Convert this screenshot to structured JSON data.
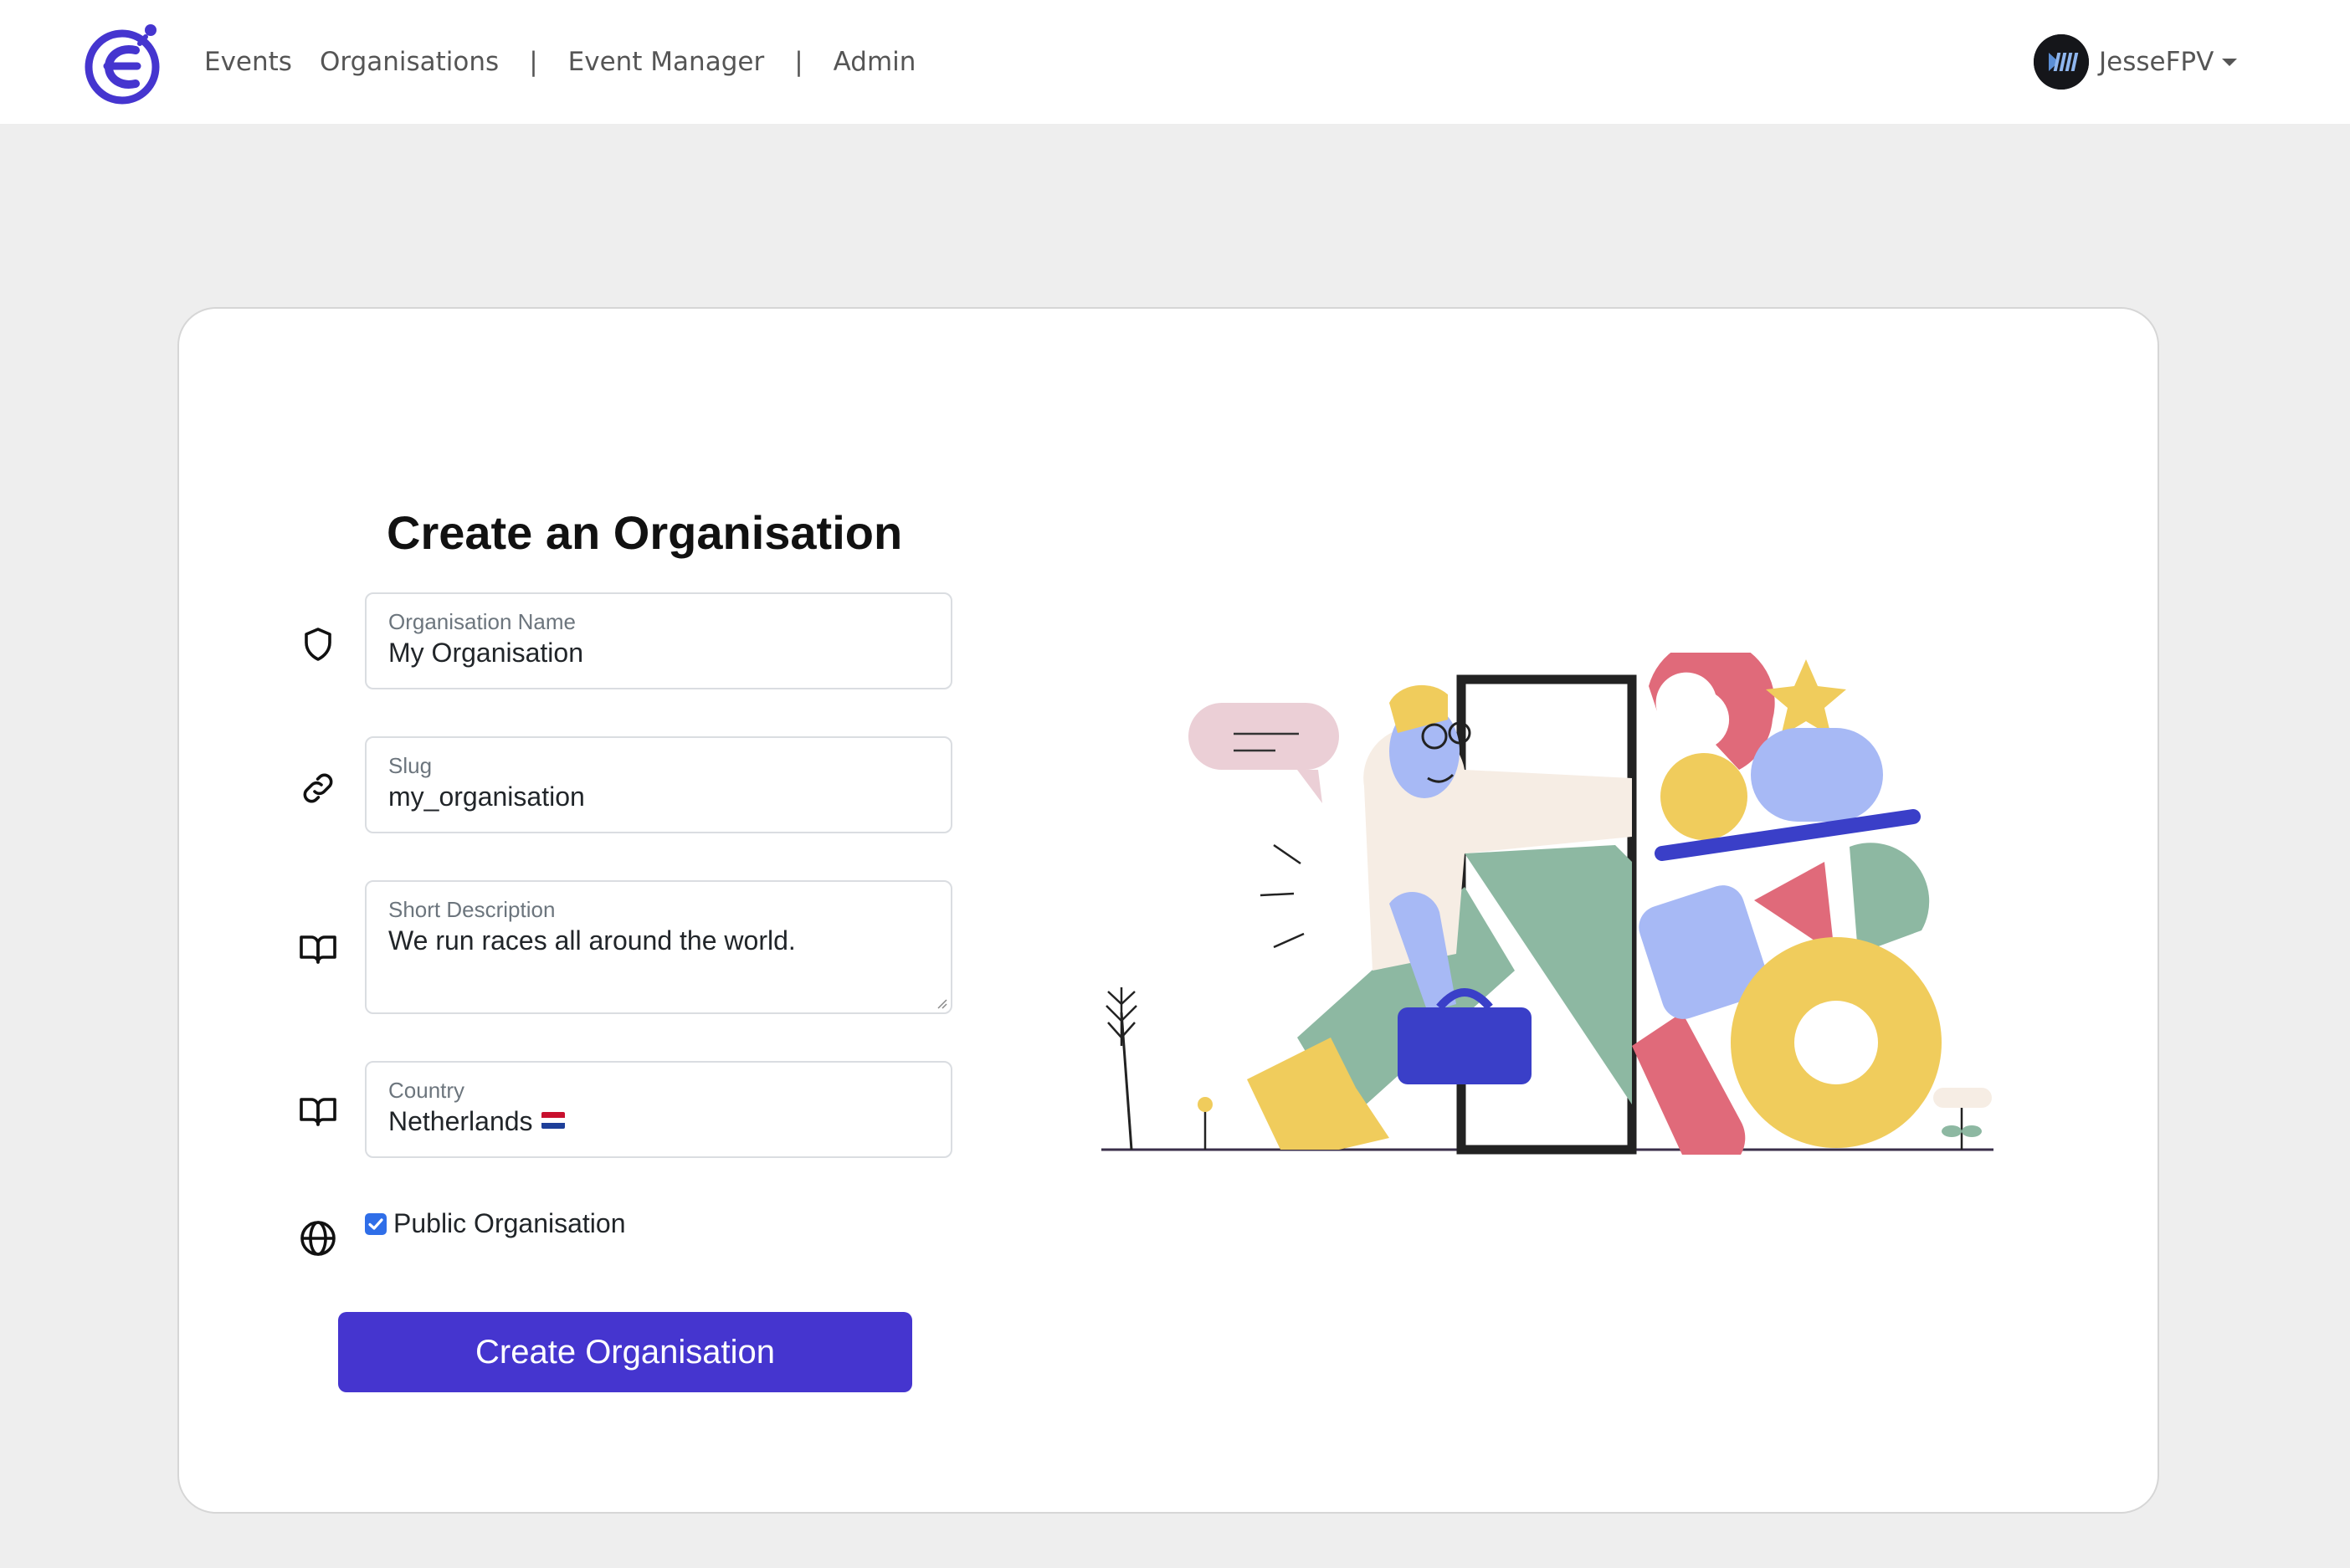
{
  "navbar": {
    "logo_icon": "stopwatch-logo-icon",
    "links": [
      {
        "label": "Events"
      },
      {
        "label": "Organisations"
      },
      {
        "label": "Event Manager"
      },
      {
        "label": "Admin"
      }
    ],
    "separator": "|",
    "user": {
      "name": "JesseFPV",
      "avatar_icon": "user-avatar-icon"
    }
  },
  "form": {
    "title": "Create an Organisation",
    "fields": {
      "name": {
        "label": "Organisation Name",
        "value": "My Organisation",
        "icon": "shield-icon"
      },
      "slug": {
        "label": "Slug",
        "value": "my_organisation",
        "icon": "link-icon"
      },
      "description": {
        "label": "Short Description",
        "value": "We run races all around the world.",
        "icon": "book-open-icon"
      },
      "country": {
        "label": "Country",
        "value": "Netherlands",
        "flag": "NL",
        "icon": "book-open-icon"
      }
    },
    "public": {
      "label": "Public Organisation",
      "checked": true,
      "icon": "globe-icon"
    },
    "submit_label": "Create Organisation"
  },
  "colors": {
    "brand": "#4535cf",
    "page_bg": "#eeeeee",
    "checkbox": "#2f6ee8"
  },
  "illustration": {
    "icon": "person-with-shapes-illustration"
  }
}
